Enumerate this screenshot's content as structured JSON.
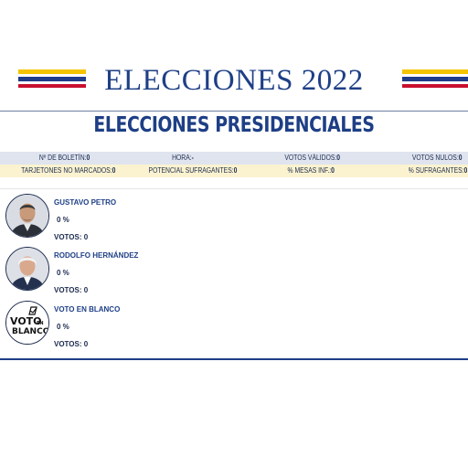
{
  "header": {
    "title": "ELECCIONES 2022",
    "subtitle": "ELECCIONES PRESIDENCIALES"
  },
  "stats": {
    "row1": [
      {
        "label": "Nº DE BOLETÍN:",
        "value": "0"
      },
      {
        "label": "HORA:",
        "value": "-"
      },
      {
        "label": "VOTOS VÁLIDOS:",
        "value": "0"
      },
      {
        "label": "VOTOS NULOS:",
        "value": "0"
      }
    ],
    "row2": [
      {
        "label": "TARJETONES NO MARCADOS:",
        "value": "0"
      },
      {
        "label": "POTENCIAL SUFRAGANTES:",
        "value": "0"
      },
      {
        "label": "% MESAS INF.:",
        "value": "0"
      },
      {
        "label": "% SUFRAGANTES:",
        "value": "0"
      }
    ]
  },
  "candidates": [
    {
      "name": "GUSTAVO PETRO",
      "percent": "0 %",
      "votes_label": "VOTOS:",
      "votes": "0"
    },
    {
      "name": "RODOLFO HERNÁNDEZ",
      "percent": "0 %",
      "votes_label": "VOTOS:",
      "votes": "0"
    },
    {
      "name": "VOTO EN BLANCO",
      "percent": "0 %",
      "votes_label": "VOTOS:",
      "votes": "0"
    }
  ],
  "blank_logo": {
    "line1": "VOTO",
    "line2": "EN",
    "line3": "BLANCO"
  },
  "colors": {
    "flag_yellow": "#f4c400",
    "flag_blue": "#1f3c8a",
    "flag_red": "#c8102e",
    "title_blue": "#1e3f86",
    "stats_row1_bg": "#dfe4ef",
    "stats_row2_bg": "#fbf3d0"
  }
}
